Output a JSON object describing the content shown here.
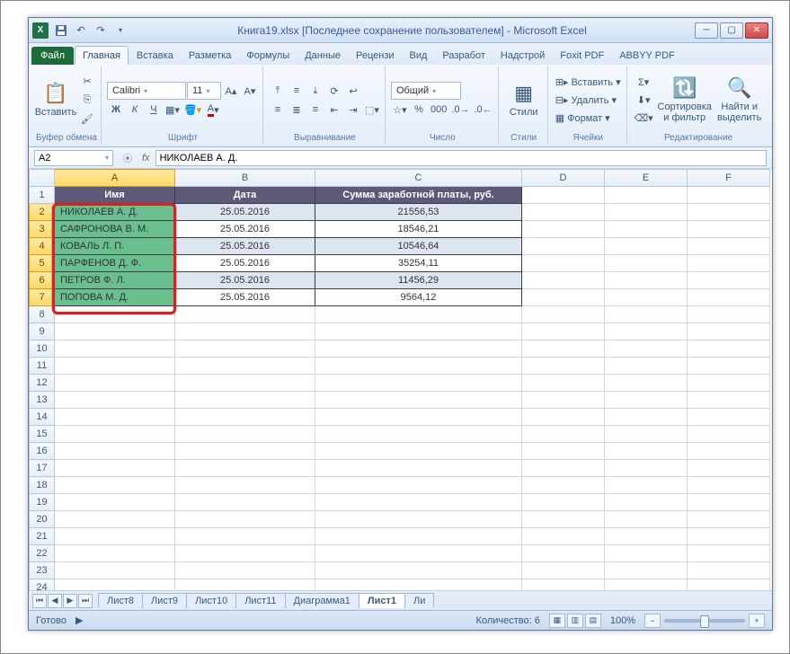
{
  "title": "Книга19.xlsx [Последнее сохранение пользователем] - Microsoft Excel",
  "tabs": {
    "file": "Файл",
    "home": "Главная",
    "insert": "Вставка",
    "layout": "Разметка",
    "formulas": "Формулы",
    "data": "Данные",
    "review": "Рецензи",
    "view": "Вид",
    "dev": "Разработ",
    "add": "Надстрой",
    "foxit": "Foxit PDF",
    "abbyy": "ABBYY PDF"
  },
  "ribbon": {
    "clipboard": {
      "label": "Буфер обмена",
      "paste": "Вставить"
    },
    "font": {
      "label": "Шрифт",
      "name": "Calibri",
      "size": "11"
    },
    "align": {
      "label": "Выравнивание"
    },
    "number": {
      "label": "Число",
      "format": "Общий"
    },
    "styles": {
      "label": "Стили",
      "btn": "Стили"
    },
    "cells": {
      "label": "Ячейки",
      "insert": "Вставить",
      "delete": "Удалить",
      "format": "Формат"
    },
    "editing": {
      "label": "Редактирование",
      "sort": "Сортировка и фильтр",
      "find": "Найти и выделить"
    }
  },
  "namebox": "A2",
  "fx": "НИКОЛАЕВ А. Д.",
  "cols": [
    "A",
    "B",
    "C",
    "D",
    "E",
    "F"
  ],
  "headers": {
    "name": "Имя",
    "date": "Дата",
    "sum": "Сумма заработной платы, руб."
  },
  "rows": [
    {
      "n": "НИКОЛАЕВ А. Д.",
      "d": "25.05.2016",
      "s": "21556,53"
    },
    {
      "n": "САФРОНОВА В. М.",
      "d": "25.05.2016",
      "s": "18546,21"
    },
    {
      "n": "КОВАЛЬ Л. П.",
      "d": "25.05.2016",
      "s": "10546,64"
    },
    {
      "n": "ПАРФЕНОВ Д. Ф.",
      "d": "25.05.2016",
      "s": "35254,11"
    },
    {
      "n": "ПЕТРОВ Ф. Л.",
      "d": "25.05.2016",
      "s": "11456,29"
    },
    {
      "n": "ПОПОВА М. Д.",
      "d": "25.05.2016",
      "s": "9564,12"
    }
  ],
  "sheets": [
    "Лист8",
    "Лист9",
    "Лист10",
    "Лист11",
    "Диаграмма1",
    "Лист1",
    "Ли"
  ],
  "status": {
    "ready": "Готово",
    "count": "Количество: 6",
    "zoom": "100%"
  }
}
